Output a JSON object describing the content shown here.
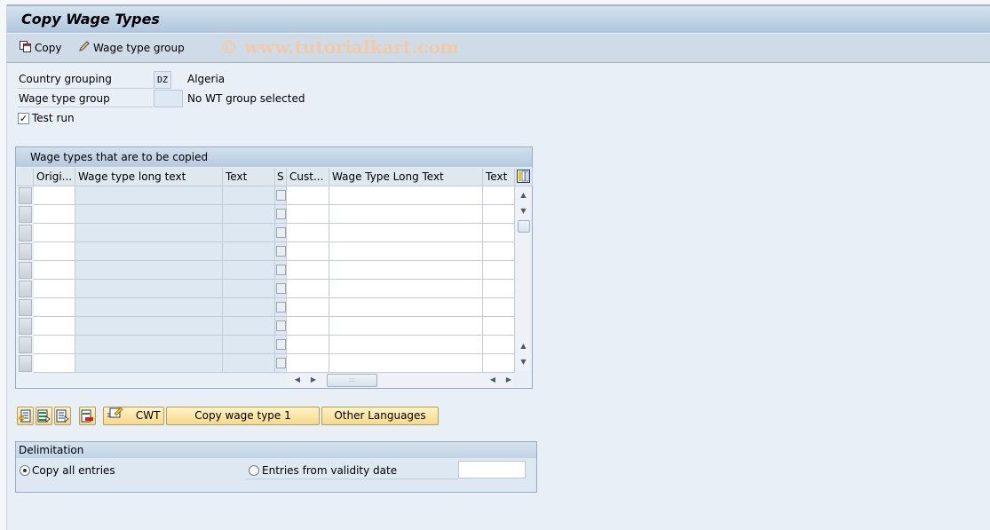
{
  "window": {
    "title": "Copy Wage Types"
  },
  "toolbar": {
    "copy_label": "Copy",
    "wage_type_group_label": "Wage type group",
    "watermark": "© www.tutorialkart.com"
  },
  "form": {
    "country_grouping_label": "Country grouping",
    "country_grouping_value": "DZ",
    "country_grouping_text": "Algeria",
    "wage_type_group_label": "Wage type group",
    "wage_type_group_value": "",
    "wage_type_group_text": "No WT group selected",
    "test_run_label": "Test run",
    "test_run_checked": true
  },
  "table": {
    "title": "Wage types that are to be copied",
    "columns": [
      {
        "label": "Origi..."
      },
      {
        "label": "Wage type long text"
      },
      {
        "label": "Text"
      },
      {
        "label": "S"
      },
      {
        "label": "Cust..."
      },
      {
        "label": "Wage Type Long Text"
      },
      {
        "label": "Text"
      }
    ],
    "row_count": 10,
    "layout_icon": "column-layout-icon"
  },
  "buttons": {
    "icons": [
      "insert-row-icon",
      "select-block-icon",
      "select-all-icon",
      "delete-row-icon"
    ],
    "cwt_label": "CWT",
    "copy_wage_type_label": "Copy wage type 1",
    "other_languages_label": "Other Languages"
  },
  "delimitation": {
    "title": "Delimitation",
    "copy_all_label": "Copy all entries",
    "copy_all_selected": true,
    "from_date_label": "Entries from validity date",
    "from_date_selected": false,
    "date_value": ""
  }
}
